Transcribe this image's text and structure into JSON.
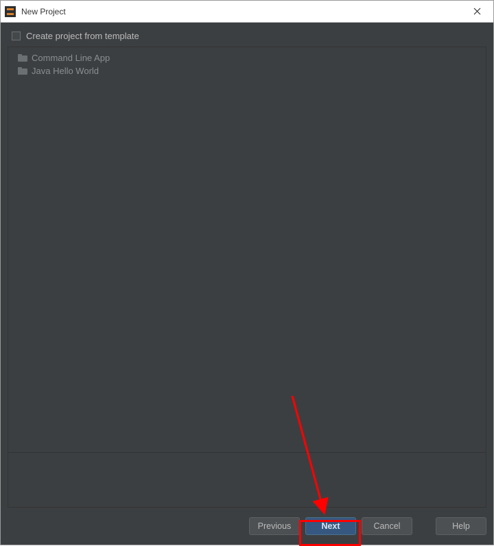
{
  "titlebar": {
    "title": "New Project"
  },
  "checkbox": {
    "label": "Create project from template",
    "checked": false
  },
  "templates": [
    {
      "label": "Command Line App"
    },
    {
      "label": "Java Hello World"
    }
  ],
  "buttons": {
    "previous": "Previous",
    "next": "Next",
    "cancel": "Cancel",
    "help": "Help"
  }
}
